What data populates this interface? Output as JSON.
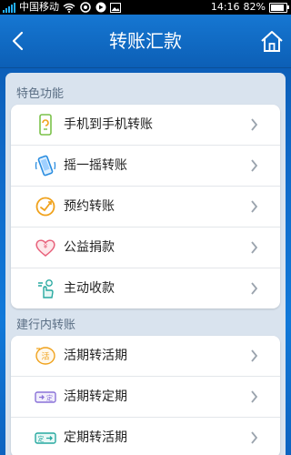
{
  "status_bar": {
    "carrier": "中国移动",
    "time": "14:16",
    "battery": "82%"
  },
  "header": {
    "title": "转账汇款",
    "back_icon": "back-arrow-icon",
    "home_icon": "home-icon"
  },
  "sections": [
    {
      "title": "特色功能",
      "items": [
        {
          "label": "手机到手机转账",
          "icon": "phone-transfer-icon"
        },
        {
          "label": "摇一摇转账",
          "icon": "shake-phone-icon"
        },
        {
          "label": "预约转账",
          "icon": "schedule-clock-icon"
        },
        {
          "label": "公益捐款",
          "icon": "heart-donation-icon"
        },
        {
          "label": "主动收款",
          "icon": "hand-collect-icon"
        }
      ]
    },
    {
      "title": "建行内转账",
      "items": [
        {
          "label": "活期转活期",
          "icon": "current-to-current-icon"
        },
        {
          "label": "活期转定期",
          "icon": "current-to-fixed-icon"
        },
        {
          "label": "定期转活期",
          "icon": "fixed-to-current-icon"
        }
      ]
    }
  ],
  "colors": {
    "header_blue": "#0c5fb6",
    "accent_green": "#7bc24a",
    "accent_orange": "#f0a21c",
    "accent_teal": "#27a9a0"
  }
}
